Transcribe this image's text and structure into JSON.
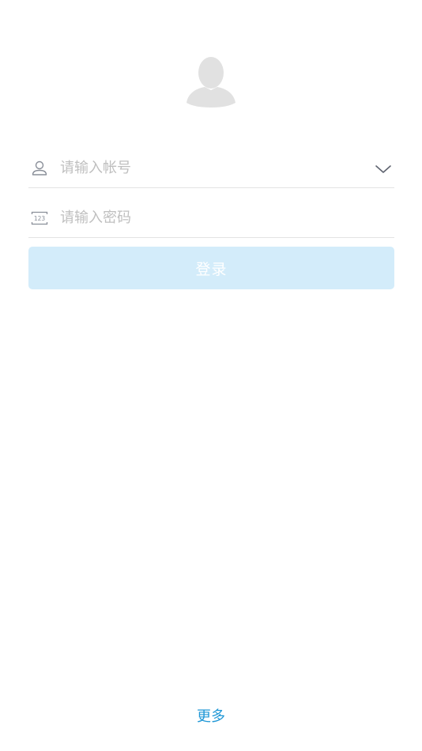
{
  "login": {
    "account_placeholder": "请输入帐号",
    "account_value": "",
    "password_placeholder": "请输入密码",
    "password_value": "",
    "login_label": "登录",
    "more_label": "更多"
  },
  "icons": {
    "avatar": "user-silhouette-icon",
    "account": "user-outline-icon",
    "password": "keypad-123-icon",
    "dropdown": "chevron-down-icon"
  },
  "colors": {
    "button_bg": "#d3ecfa",
    "button_text": "#ffffff",
    "link": "#1f97d6",
    "placeholder": "#bfbfbf",
    "divider": "#e3e3e3",
    "avatar": "#e1e1e1"
  }
}
